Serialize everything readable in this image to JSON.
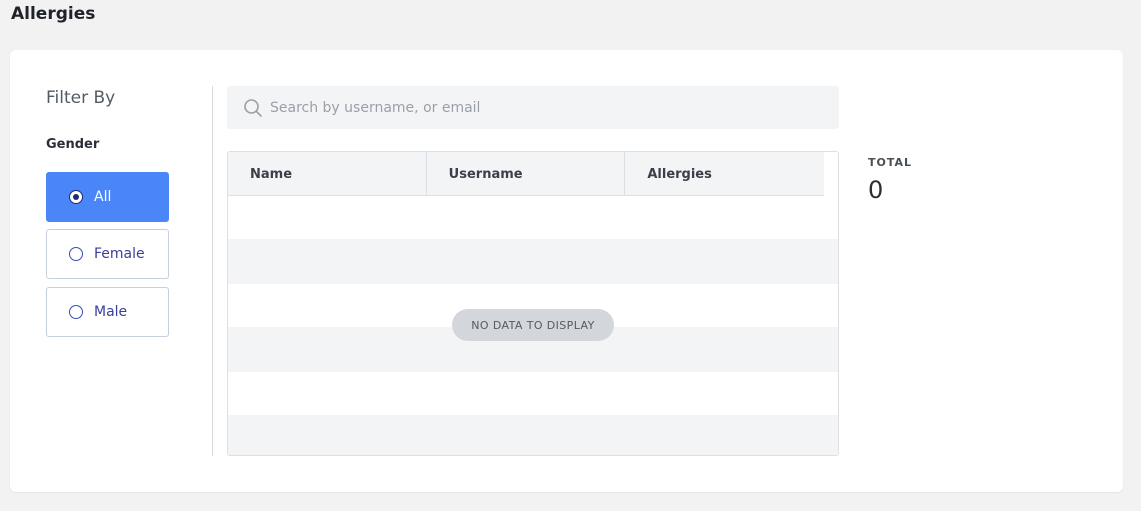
{
  "page": {
    "title": "Allergies"
  },
  "filter": {
    "title": "Filter By",
    "group_label": "Gender",
    "options": [
      {
        "label": "All",
        "selected": true
      },
      {
        "label": "Female",
        "selected": false
      },
      {
        "label": "Male",
        "selected": false
      }
    ]
  },
  "search": {
    "placeholder": "Search by username, or email",
    "value": "",
    "icon": "search-icon"
  },
  "table": {
    "columns": [
      "Name",
      "Username",
      "Allergies"
    ],
    "rows": [],
    "empty_message": "NO DATA TO DISPLAY"
  },
  "summary": {
    "total_label": "TOTAL",
    "total_value": "0"
  },
  "colors": {
    "accent": "#4a86f7",
    "background": "#f2f2f2",
    "stripe": "#f3f4f6"
  }
}
